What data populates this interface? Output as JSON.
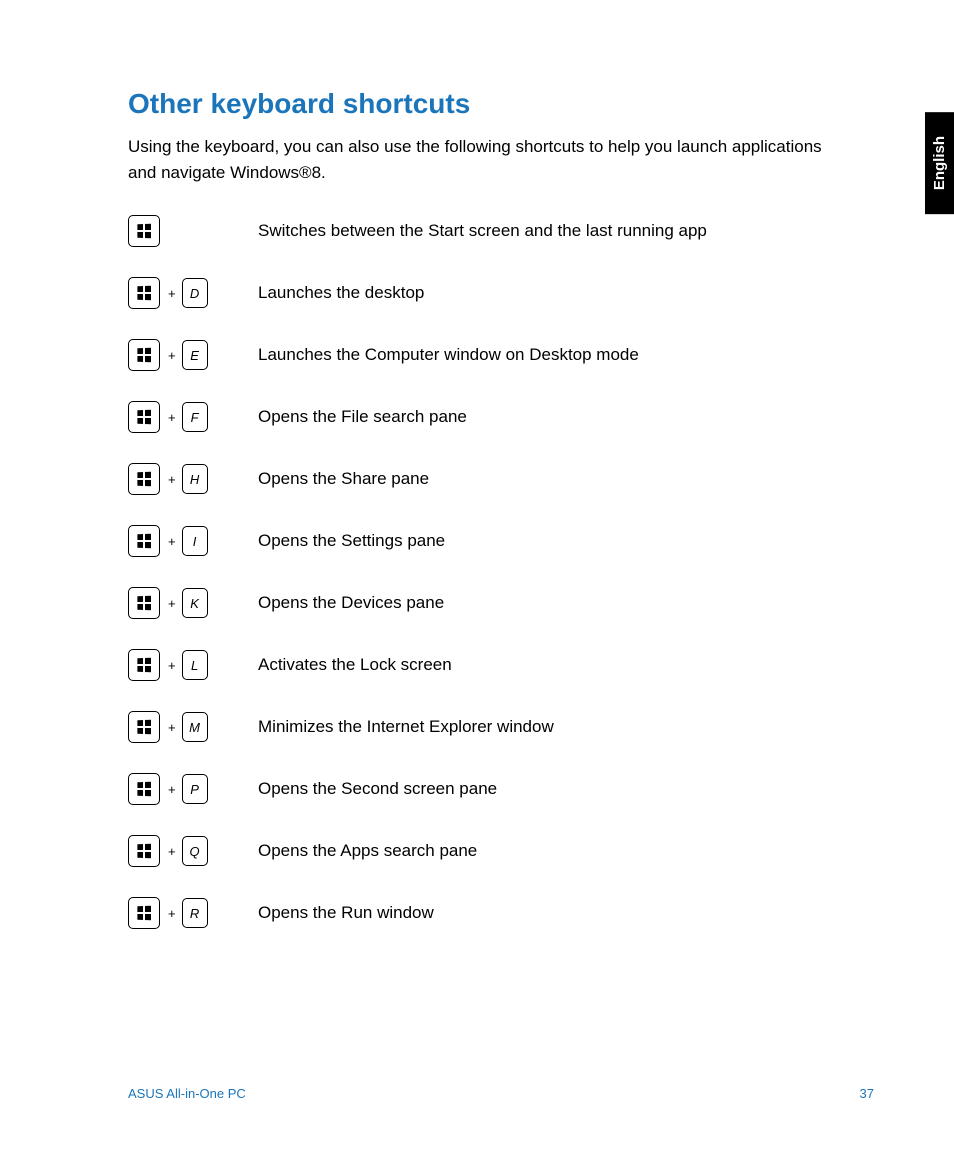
{
  "heading": "Other keyboard shortcuts",
  "intro": "Using the keyboard, you can also use the following shortcuts to help you launch applications and navigate Windows®8.",
  "language_tab": "English",
  "plus": "+",
  "shortcuts": [
    {
      "keys": [
        ""
      ],
      "desc": "Switches between the Start screen and the last running app"
    },
    {
      "keys": [
        "",
        "D"
      ],
      "desc": "Launches the desktop"
    },
    {
      "keys": [
        "",
        "E"
      ],
      "desc": "Launches the Computer window on Desktop mode"
    },
    {
      "keys": [
        "",
        "F"
      ],
      "desc": "Opens the File search pane"
    },
    {
      "keys": [
        "",
        "H"
      ],
      "desc": "Opens the Share pane"
    },
    {
      "keys": [
        "",
        "I"
      ],
      "desc": "Opens the Settings pane"
    },
    {
      "keys": [
        "",
        "K"
      ],
      "desc": "Opens the Devices pane"
    },
    {
      "keys": [
        "",
        "L"
      ],
      "desc": "Activates the Lock screen"
    },
    {
      "keys": [
        "",
        "M"
      ],
      "desc": "Minimizes the Internet Explorer window"
    },
    {
      "keys": [
        "",
        "P"
      ],
      "desc": "Opens the Second screen pane"
    },
    {
      "keys": [
        "",
        "Q"
      ],
      "desc": "Opens the Apps search pane"
    },
    {
      "keys": [
        "",
        "R"
      ],
      "desc": "Opens the Run window"
    }
  ],
  "footer": {
    "product": "ASUS All-in-One PC",
    "page": "37"
  }
}
